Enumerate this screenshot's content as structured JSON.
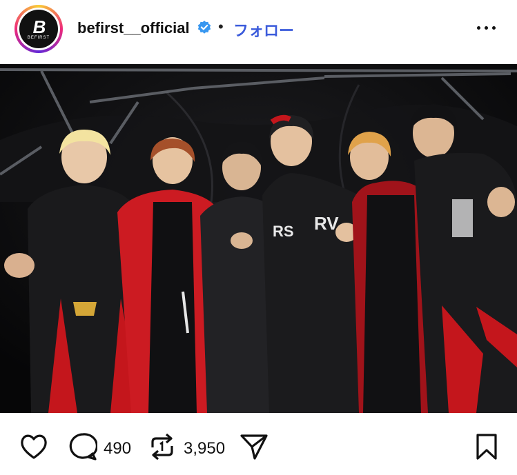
{
  "post": {
    "username": "befirst__official",
    "separator": "•",
    "follow_label": "フォロー",
    "avatar": {
      "logo_mark": "B",
      "logo_text": "BEFIRST"
    },
    "verified_icon": "verified-badge-icon",
    "more_icon": "more-options-icon"
  },
  "actions": {
    "comments_count": "490",
    "reposts_count": "3,950",
    "icons": [
      "heart-icon",
      "comment-icon",
      "repost-icon",
      "share-icon",
      "bookmark-icon"
    ]
  },
  "colors": {
    "follow": "#3b5bdb",
    "verified": "#3897f0",
    "photo_background": "#0b0b0c",
    "accent_red": "#c4161c"
  }
}
